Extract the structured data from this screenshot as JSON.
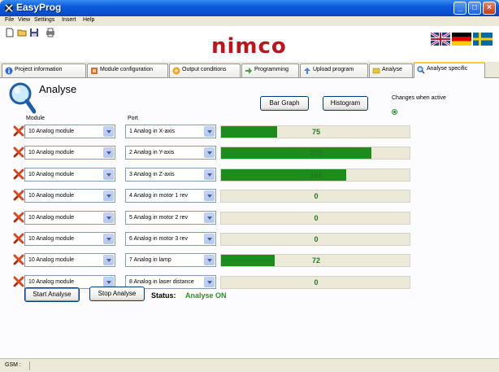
{
  "window": {
    "title": "EasyProg"
  },
  "menu": [
    "File",
    "View",
    "Settings",
    "Insert",
    "Help"
  ],
  "toolbar": {
    "icons": [
      "new-file-icon",
      "open-folder-icon",
      "save-icon",
      "print-icon"
    ]
  },
  "brand": {
    "logo": "nimco",
    "logo_color": "#C0141C"
  },
  "flags": [
    "uk-flag",
    "german-flag",
    "swedish-flag"
  ],
  "tabs": [
    {
      "label": "Project information",
      "icon": "info-icon"
    },
    {
      "label": "Module configuration",
      "icon": "module-icon"
    },
    {
      "label": "Output conditions",
      "icon": "output-icon"
    },
    {
      "label": "Programming",
      "icon": "programming-icon"
    },
    {
      "label": "Upload program",
      "icon": "upload-icon"
    },
    {
      "label": "Analyse",
      "icon": "analyse-icon"
    },
    {
      "label": "Analyse specific",
      "icon": "search-icon",
      "active": true
    }
  ],
  "analyse": {
    "heading": "Analyse",
    "module_header": "Module",
    "port_header": "Port",
    "bar_graph_label": "Bar Graph",
    "histogram_label": "Histogram",
    "changes_hint": "Changes when active",
    "bar_max": 255,
    "rows": [
      {
        "module": "10 Analog module",
        "port": "1  Analog in X-axis",
        "value": "75"
      },
      {
        "module": "10 Analog module",
        "port": "2  Analog in Y-axis",
        "value": "202"
      },
      {
        "module": "10 Analog module",
        "port": "3  Analog in Z-axis",
        "value": "168"
      },
      {
        "module": "10 Analog module",
        "port": "4  Analog in motor 1 rev",
        "value": "0"
      },
      {
        "module": "10 Analog module",
        "port": "5  Analog in motor 2 rev",
        "value": "0"
      },
      {
        "module": "10 Analog module",
        "port": "6  Analog in motor 3 rev",
        "value": "0"
      },
      {
        "module": "10 Analog module",
        "port": "7  Analog in lamp",
        "value": "72"
      },
      {
        "module": "10 Analog module",
        "port": "8  Analog in laser distance",
        "value": "0"
      }
    ],
    "start_label": "Start Analyse",
    "stop_label": "Stop Analyse",
    "status_label": "Status:",
    "status_value": "Analyse ON",
    "status_color": "#2E8B2E"
  },
  "statusbar": {
    "text": "GSM :"
  }
}
